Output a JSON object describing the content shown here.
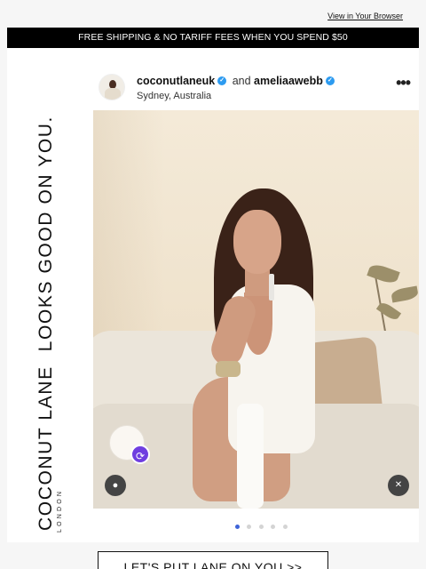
{
  "topbar": {
    "view_in_browser": "View in Your Browser"
  },
  "banner": {
    "text": "FREE SHIPPING & NO TARIFF FEES WHEN YOU SPEND $50"
  },
  "brand": {
    "name": "COCONUT LANE",
    "tagline": "LOOKS GOOD ON YOU.",
    "city": "LONDON"
  },
  "post": {
    "user1": "coconutlaneuk",
    "and_text": "and",
    "user2": "ameliaawebb",
    "location": "Sydney, Australia",
    "more_icon": "more-horizontal-icon",
    "dots_total": 5,
    "dots_active_index": 0
  },
  "cta": {
    "label": "LET'S PUT LANE ON YOU >>"
  },
  "colors": {
    "banner_bg": "#000000",
    "verified": "#2d9bf0",
    "collab_badge": "#6f3ee0",
    "active_dot": "#3e64d8"
  }
}
